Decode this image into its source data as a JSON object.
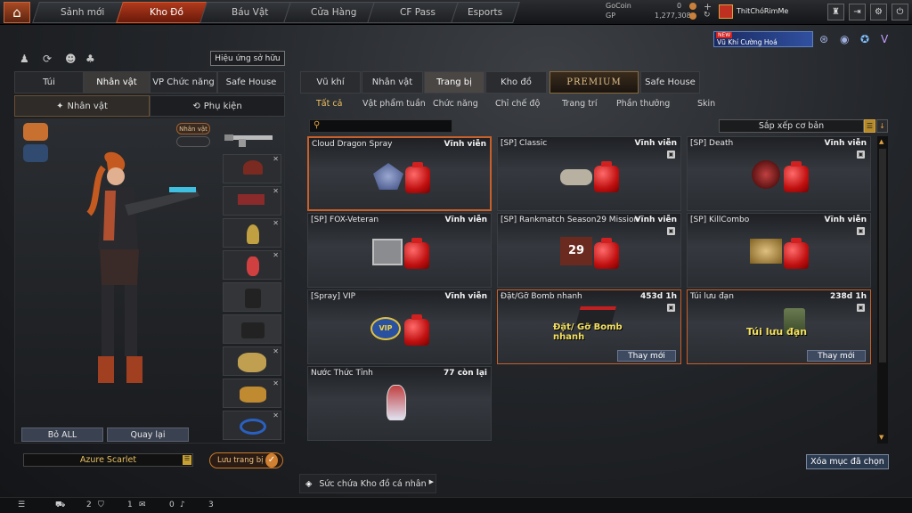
{
  "nav": {
    "tabs": [
      "Sảnh mới",
      "Kho Đồ",
      "Báu Vật",
      "Cửa Hàng",
      "CF Pass",
      "Esports"
    ]
  },
  "wallet": {
    "gocoin_label": "GoCoin",
    "gocoin_value": "0",
    "gp_label": "GP",
    "gp_value": "1,277,308"
  },
  "user": {
    "name": "ThitChóRimMe"
  },
  "promo": {
    "badge": "NEW",
    "text": "Vũ Khí Cường Hoá"
  },
  "left": {
    "owned_effects_btn": "Hiệu ứng sở hữu",
    "tabs": [
      "Túi",
      "Nhân vật",
      "VP Chức năng",
      "Safe House"
    ],
    "subtabs": [
      "Nhân vật",
      "Phụ kiện"
    ],
    "char_badge": "Nhân vật",
    "drop_all": "Bỏ ALL",
    "back": "Quay lại",
    "char_name": "Azure Scarlet",
    "save_btn": "Lưu trang bị"
  },
  "right": {
    "tabs": [
      "Vũ khí",
      "Nhân vật",
      "Trang bị",
      "Kho đồ",
      "PREMIUM",
      "Safe House"
    ],
    "subtabs": [
      "Tất cả",
      "Vật phẩm tuần",
      "Chức năng",
      "Chỉ chế độ",
      "Trang trí",
      "Phần thưởng",
      "Skin"
    ],
    "search_placeholder": "",
    "sort_label": "Sắp xếp cơ bản",
    "clear_btn": "Xóa mục đã chọn",
    "capacity_label": "Sức chứa Kho đồ cá nhân"
  },
  "items": [
    {
      "name": "Cloud Dragon Spray",
      "time": "Vĩnh viễn"
    },
    {
      "name": "[SP] Classic",
      "time": "Vĩnh viễn"
    },
    {
      "name": "[SP] Death",
      "time": "Vĩnh viễn"
    },
    {
      "name": "[SP] FOX-Veteran",
      "time": "Vĩnh viễn"
    },
    {
      "name": "[SP] Rankmatch Season29 Mission",
      "time": "Vĩnh viễn",
      "art_num": "29"
    },
    {
      "name": "[SP] KillCombo",
      "time": "Vĩnh viễn"
    },
    {
      "name": "[Spray] VIP",
      "time": "Vĩnh viễn",
      "art_text": "VIP"
    },
    {
      "name": "Đặt/Gỡ Bomb nhanh",
      "time": "453d 1h",
      "big": "Đặt/ Gỡ Bomb nhanh",
      "renew": "Thay mới"
    },
    {
      "name": "Túi lưu đạn",
      "time": "238d 1h",
      "big": "Túi lưu đạn",
      "renew": "Thay mới"
    },
    {
      "name": "Nước Thức Tỉnh",
      "time": "77 còn lại"
    }
  ],
  "bottom": {
    "count1": "2",
    "count2": "1",
    "count3": "0",
    "count4": "3"
  }
}
